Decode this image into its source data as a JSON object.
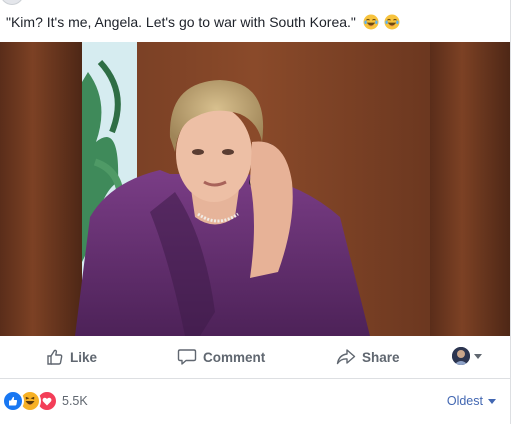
{
  "post": {
    "caption": "\"Kim? It's me, Angela. Let's go to war with South Korea.\"",
    "caption_emojis": [
      "laughing-tears-emoji",
      "laughing-tears-emoji"
    ]
  },
  "actions": {
    "like_label": "Like",
    "comment_label": "Comment",
    "share_label": "Share"
  },
  "reactions": {
    "types": [
      "like",
      "haha",
      "love"
    ],
    "count": "5.5K"
  },
  "comments": {
    "sort_label": "Oldest"
  },
  "colors": {
    "like": "#1877f2",
    "haha": "#f7b125",
    "love": "#f33e58",
    "link": "#4267b2",
    "muted": "#606770"
  }
}
